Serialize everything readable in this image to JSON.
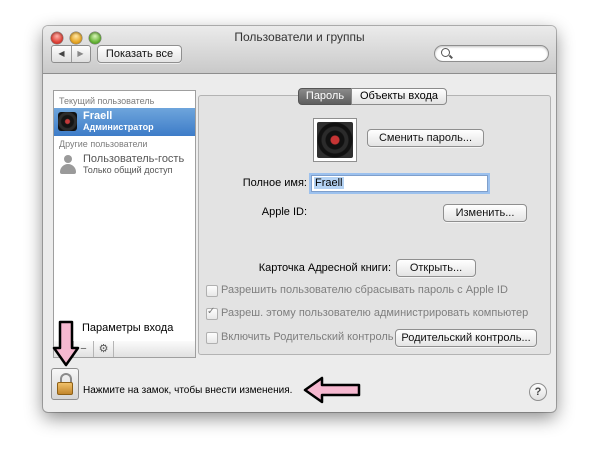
{
  "window": {
    "title": "Пользователи и группы"
  },
  "toolbar": {
    "back_glyph": "◀",
    "forward_glyph": "▶",
    "show_all_label": "Показать все",
    "search_placeholder": ""
  },
  "sidebar": {
    "current_user_header": "Текущий пользователь",
    "current_user": {
      "name": "Fraell",
      "role": "Администратор"
    },
    "other_users_header": "Другие пользователи",
    "guest": {
      "name": "Пользователь-гость",
      "role": "Только общий доступ"
    },
    "login_options_label": "Параметры входа",
    "add_glyph": "+",
    "remove_glyph": "−",
    "gear_glyph": "⚙"
  },
  "tabs": [
    {
      "label": "Пароль",
      "active": true
    },
    {
      "label": "Объекты входа",
      "active": false
    }
  ],
  "account": {
    "change_password_label": "Сменить пароль...",
    "full_name_label": "Полное имя:",
    "full_name_value": "Fraell",
    "apple_id_label": "Apple ID:",
    "change_apple_id_label": "Изменить...",
    "address_card_label": "Карточка Адресной книги:",
    "open_label": "Открыть...",
    "options": [
      {
        "label": "Разрешить пользователю сбрасывать пароль с Apple ID",
        "checked": false
      },
      {
        "label": "Разреш. этому пользователю администрировать компьютер",
        "checked": true
      },
      {
        "label": "Включить Родительский контроль",
        "checked": false
      }
    ],
    "parental_controls_label": "Родительский контроль..."
  },
  "footer": {
    "lock_text": "Нажмите на замок, чтобы внести изменения.",
    "help_glyph": "?"
  },
  "colors": {
    "selection": "#3d7cc8",
    "arrow_fill": "#f6b8d0",
    "lock_body": "#e0a64a"
  }
}
